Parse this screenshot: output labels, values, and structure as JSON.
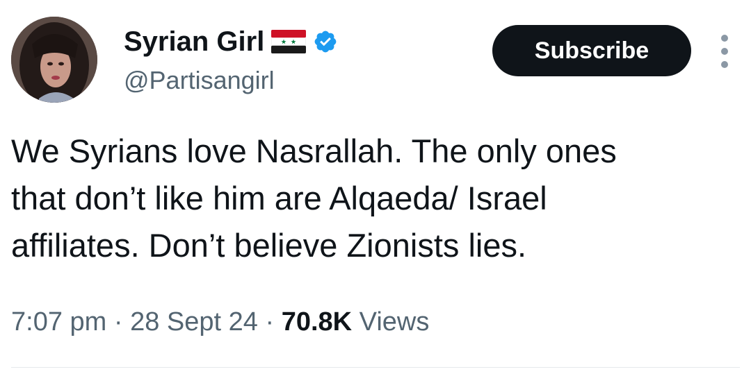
{
  "author": {
    "display_name": "Syrian Girl",
    "handle": "@Partisangirl",
    "flag": "syria-flag-icon",
    "verified": "verified-badge-icon",
    "verified_color": "#1d9bf0"
  },
  "actions": {
    "subscribe_label": "Subscribe",
    "more_icon": "more-vertical-icon"
  },
  "tweet": {
    "text": "We Syrians love Nasrallah. The only ones\nthat don’t like him are Alqaeda/ Israel\naffiliates. Don’t believe Zionists lies."
  },
  "meta": {
    "time": "7:07 pm",
    "separator": "·",
    "date": "28 Sept 24",
    "views_count": "70.8K",
    "views_label": "Views"
  }
}
